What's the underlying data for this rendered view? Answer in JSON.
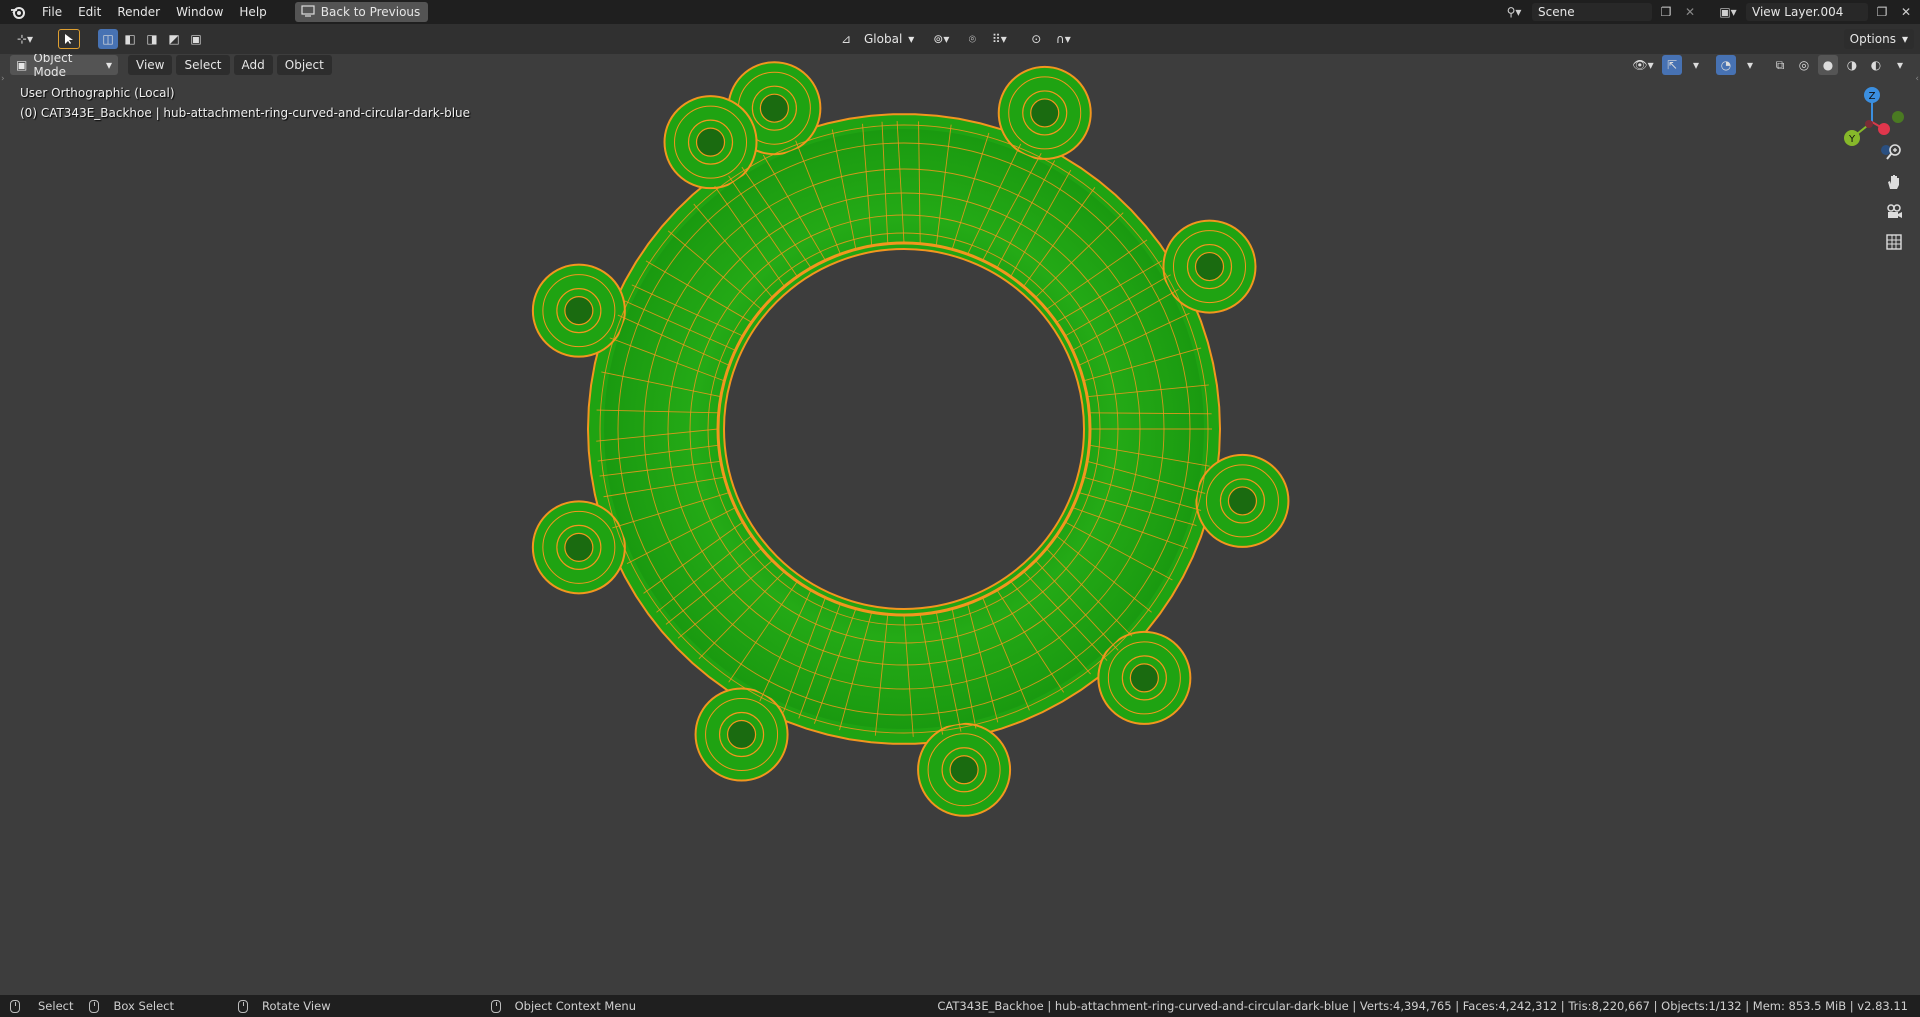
{
  "topbar": {
    "menus": [
      "File",
      "Edit",
      "Render",
      "Window",
      "Help"
    ],
    "back_button": "Back to Previous",
    "scene": "Scene",
    "view_layer": "View Layer.004"
  },
  "header": {
    "transform_orientation": "Global",
    "options_label": "Options"
  },
  "viewport_header": {
    "mode": "Object Mode",
    "menus": [
      "View",
      "Select",
      "Add",
      "Object"
    ]
  },
  "viewport": {
    "view_name": "User Orthographic (Local)",
    "object_label": "(0) CAT343E_Backhoe | hub-attachment-ring-curved-and-circular-dark-blue",
    "gizmo": {
      "z": "Z",
      "y": "Y"
    },
    "colors": {
      "mesh": "#1fa312",
      "wire": "#f2961e",
      "background": "#3d3d3d"
    }
  },
  "statusbar": {
    "select": "Select",
    "box_select": "Box Select",
    "rotate_view": "Rotate View",
    "context_menu": "Object Context Menu",
    "stats": "CAT343E_Backhoe | hub-attachment-ring-curved-and-circular-dark-blue | Verts:4,394,765 | Faces:4,242,312 | Tris:8,220,667 | Objects:1/132 | Mem: 853.5 MiB | v2.83.11"
  }
}
